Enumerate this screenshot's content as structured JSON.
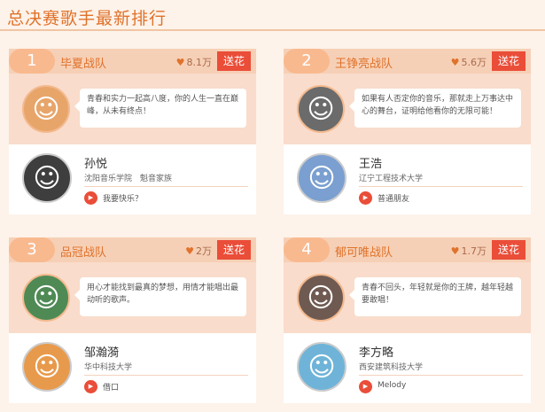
{
  "page": {
    "title": "总决赛歌手最新排行"
  },
  "colors": {
    "accent": "#e0722b",
    "gift_button": "#ea4d38",
    "head_bg": "#f6d0b6",
    "coach_bg": "#f9dccb"
  },
  "cards": [
    {
      "rank": "1",
      "team": "毕夏战队",
      "votes": "8.1万",
      "gift_label": "送花",
      "coach_quote": "青春和实力一起高八度，你的人生一直在巅峰，从未有终点！",
      "singer": {
        "name": "孙悦",
        "school": "沈阳音乐学院　魁音家族",
        "song": "我要快乐？"
      }
    },
    {
      "rank": "2",
      "team": "王铮亮战队",
      "votes": "5.6万",
      "gift_label": "送花",
      "coach_quote": "如果有人否定你的音乐，那就走上万事达中心的舞台，证明给他看你的无限可能！",
      "singer": {
        "name": "王浩",
        "school": "辽宁工程技术大学",
        "song": "普通朋友"
      }
    },
    {
      "rank": "3",
      "team": "品冠战队",
      "votes": "2万",
      "gift_label": "送花",
      "coach_quote": "用心才能找到最真的梦想，用情才能唱出最动听的歌声。",
      "singer": {
        "name": "邹瀚漪",
        "school": "华中科技大学",
        "song": "借口"
      }
    },
    {
      "rank": "4",
      "team": "郁可唯战队",
      "votes": "1.7万",
      "gift_label": "送花",
      "coach_quote": "青春不回头，年轻就是你的王牌，越年轻越要敢唱！",
      "singer": {
        "name": "李方略",
        "school": "西安建筑科技大学",
        "song": "Melody"
      }
    }
  ],
  "icons": {
    "votes": "heart-icon",
    "play": "play-icon"
  }
}
